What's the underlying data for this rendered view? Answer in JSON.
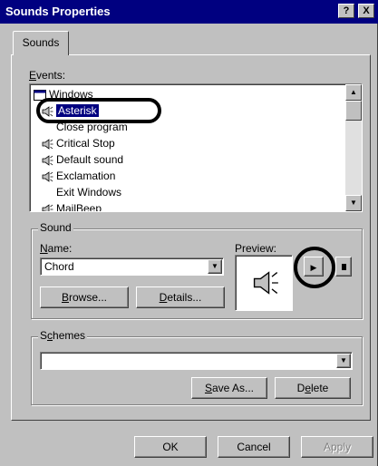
{
  "window": {
    "title": "Sounds Properties",
    "help_btn": "?",
    "close_btn": "X"
  },
  "tabs": [
    {
      "label": "Sounds"
    }
  ],
  "events": {
    "label": "Events:",
    "items": [
      {
        "label": "Windows",
        "icon": "windows-folder-icon"
      },
      {
        "label": "Asterisk",
        "icon": "speaker-icon",
        "selected": true
      },
      {
        "label": "Close program",
        "icon": "none"
      },
      {
        "label": "Critical Stop",
        "icon": "speaker-icon"
      },
      {
        "label": "Default sound",
        "icon": "speaker-icon"
      },
      {
        "label": "Exclamation",
        "icon": "speaker-icon"
      },
      {
        "label": "Exit Windows",
        "icon": "none"
      },
      {
        "label": "MailBeep",
        "icon": "speaker-icon"
      }
    ]
  },
  "sound": {
    "group_label": "Sound",
    "name_label": "Name:",
    "name_value": "Chord",
    "preview_label": "Preview:",
    "browse_label": "Browse...",
    "details_label": "Details..."
  },
  "schemes": {
    "group_label": "Schemes",
    "value": "",
    "save_as_label": "Save As...",
    "delete_label": "Delete"
  },
  "footer": {
    "ok_label": "OK",
    "cancel_label": "Cancel",
    "apply_label": "Apply"
  },
  "colors": {
    "titlebar": "#000080",
    "face": "#c0c0c0",
    "selection": "#000080"
  }
}
